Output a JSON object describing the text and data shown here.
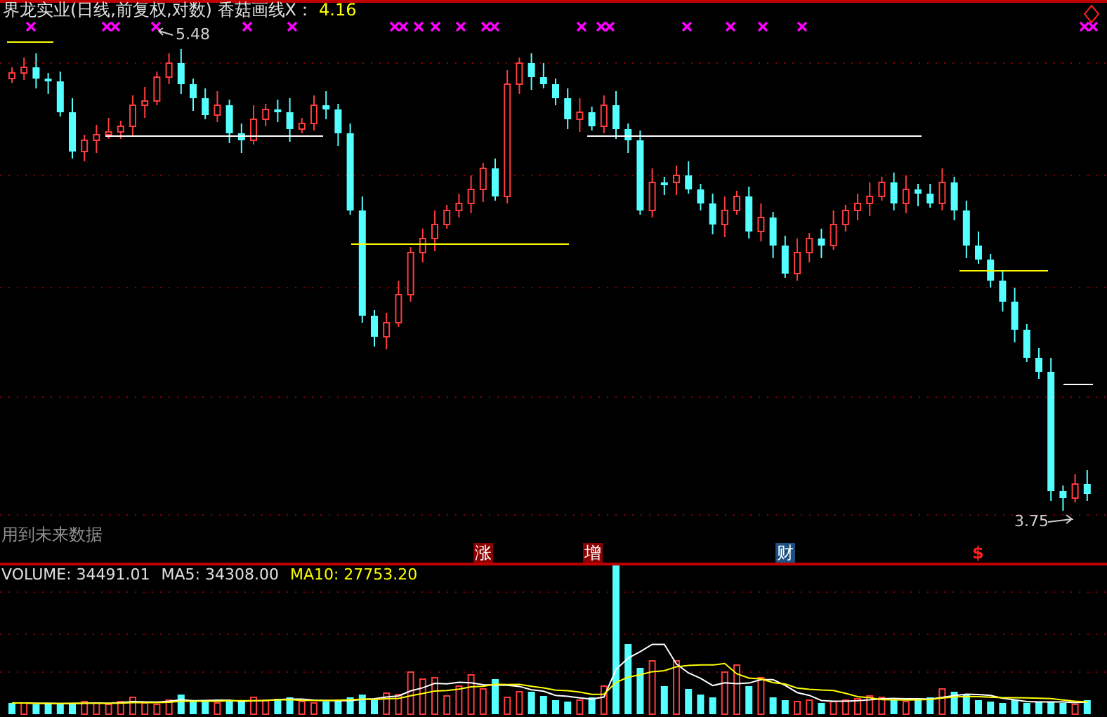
{
  "title": {
    "text": "界龙实业(日线,前复权,对数) 香菇画线X：",
    "value": "4.16"
  },
  "price_labels": {
    "high": "5.48",
    "low": "3.75"
  },
  "warning": "用到未来数据",
  "markers": [
    {
      "label": "涨",
      "kind": "badge",
      "color": "#8b0000"
    },
    {
      "label": "增",
      "kind": "badge",
      "color": "#8b0000"
    },
    {
      "label": "财",
      "kind": "badge",
      "color": "#1d4f80"
    },
    {
      "label": "$",
      "kind": "text",
      "color": "#ff2020"
    }
  ],
  "volume_legend": [
    {
      "text": "VOLUME: 34491.01",
      "color": "#e0e0e0"
    },
    {
      "text": "MA5: 34308.00",
      "color": "#e0e0e0"
    },
    {
      "text": "MA10: 27753.20",
      "color": "#ffff00"
    }
  ]
}
